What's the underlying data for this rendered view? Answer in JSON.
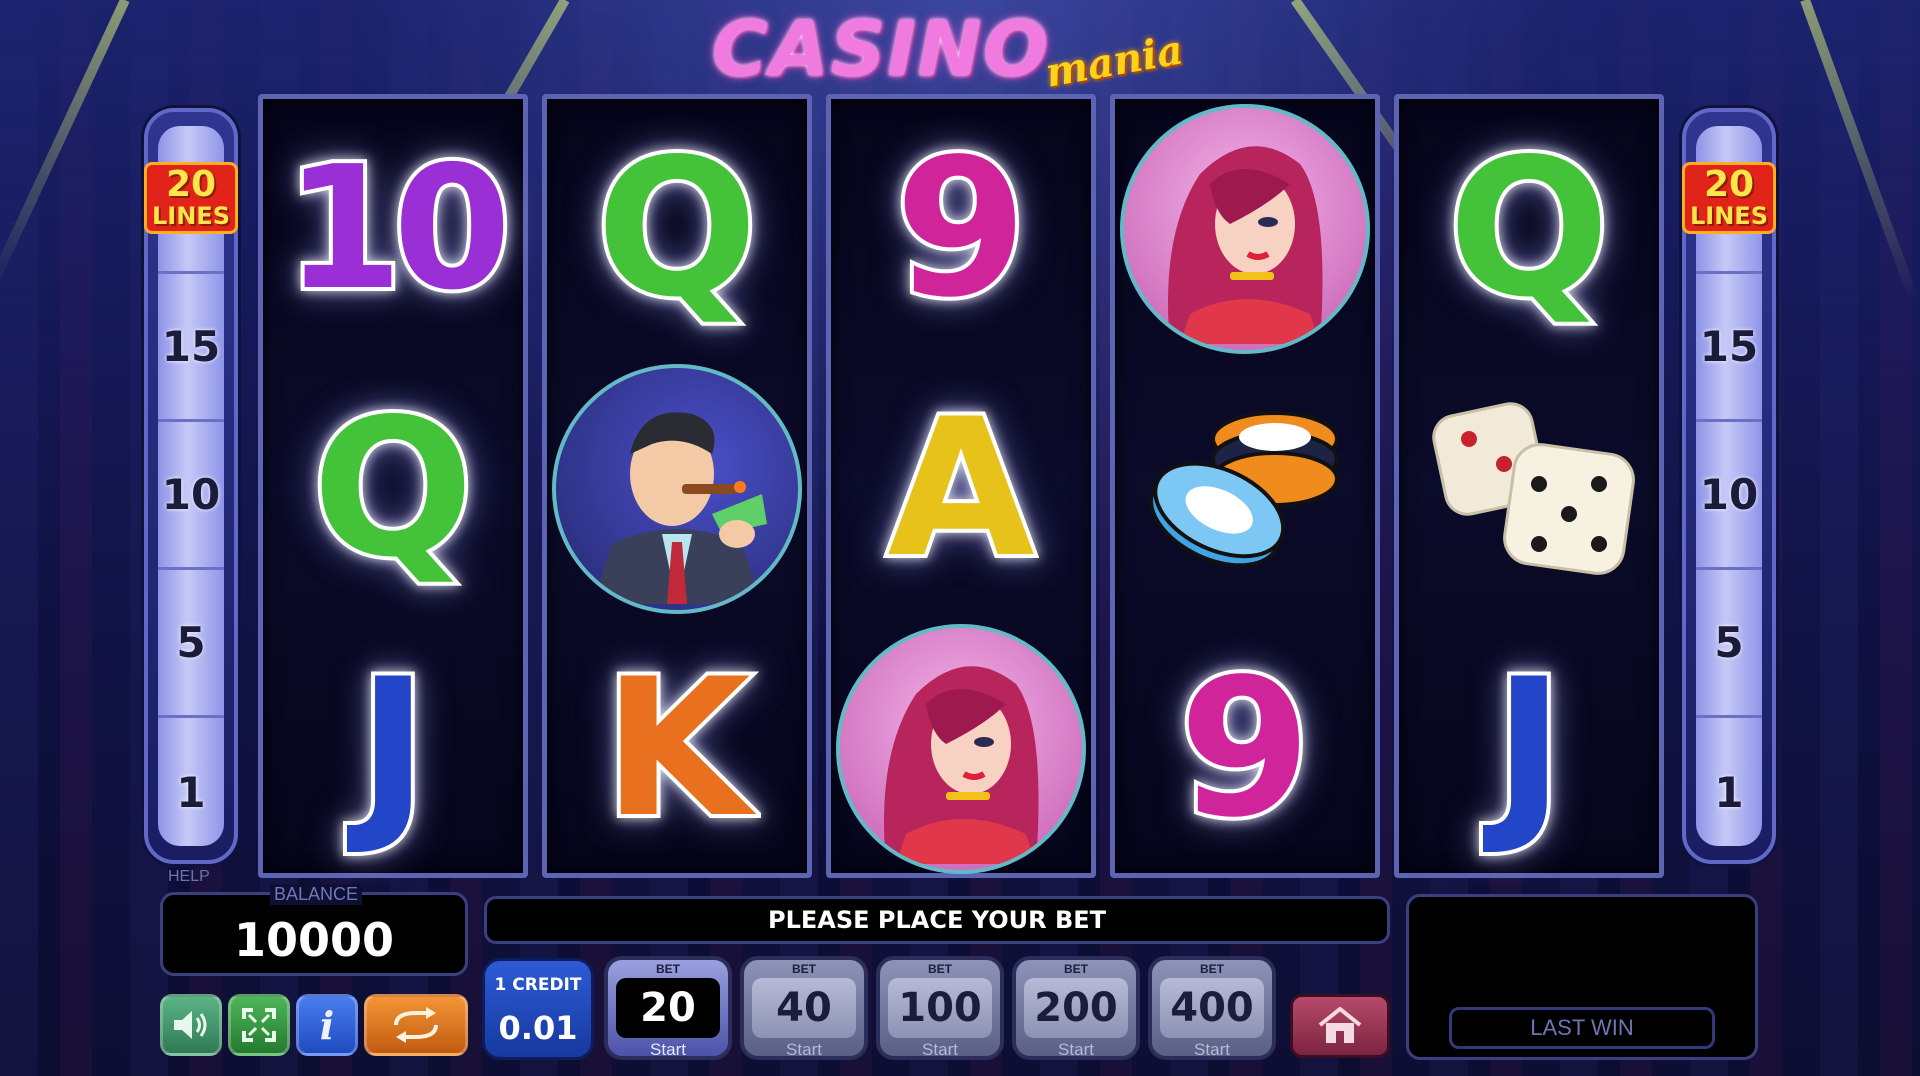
{
  "game": {
    "logo_main": "CASINO",
    "logo_sub": "mania"
  },
  "lines": {
    "badge_count": "20",
    "badge_word": "LINES",
    "markers": [
      "15",
      "10",
      "5",
      "1"
    ]
  },
  "reels": [
    [
      "10",
      "Q",
      "J"
    ],
    [
      "Q",
      "businessman",
      "K"
    ],
    [
      "9",
      "A",
      "lady"
    ],
    [
      "lady",
      "chips",
      "9"
    ],
    [
      "Q",
      "dice",
      "J"
    ]
  ],
  "symbol_colors": {
    "10": "#9b2fd6",
    "Q": "#44c23a",
    "J": "#2346c8",
    "K": "#e8701e",
    "9": "#d0259a",
    "A": "#e7c21a"
  },
  "hud": {
    "help_label": "HELP",
    "balance_label": "BALANCE",
    "balance_value": "10000",
    "message": "PLEASE PLACE YOUR BET",
    "last_win_label": "LAST WIN",
    "credit_label": "1 CREDIT",
    "credit_value": "0.01",
    "bet_label": "BET",
    "start_label": "Start",
    "bets": [
      "20",
      "40",
      "100",
      "200",
      "400"
    ],
    "active_bet_index": 0
  },
  "icons": {
    "sound": "speaker-icon",
    "fullscreen": "fullscreen-icon",
    "info": "info-icon",
    "autoplay": "autoplay-icon",
    "home": "home-icon"
  },
  "colors": {
    "sound_btn": "#4a9b74",
    "fullscreen_btn": "#3aa04a",
    "info_btn": "#2e5fd8",
    "autoplay_btn": "#e8761e"
  }
}
